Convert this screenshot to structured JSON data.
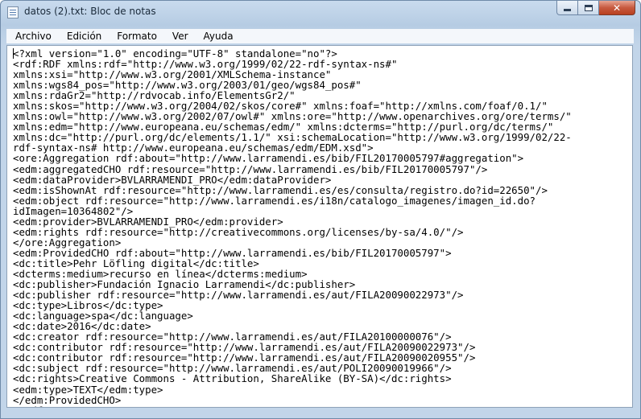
{
  "window": {
    "title": "datos (2).txt: Bloc de notas",
    "close_glyph": "✕"
  },
  "menu": {
    "items": [
      "Archivo",
      "Edición",
      "Formato",
      "Ver",
      "Ayuda"
    ]
  },
  "editor": {
    "lines": [
      "<?xml version=\"1.0\" encoding=\"UTF-8\" standalone=\"no\"?>",
      "<rdf:RDF xmlns:rdf=\"http://www.w3.org/1999/02/22-rdf-syntax-ns#\"",
      "xmlns:xsi=\"http://www.w3.org/2001/XMLSchema-instance\"",
      "xmlns:wgs84_pos=\"http://www.w3.org/2003/01/geo/wgs84_pos#\"",
      "xmlns:rdaGr2=\"http://rdvocab.info/ElementsGr2/\"",
      "xmlns:skos=\"http://www.w3.org/2004/02/skos/core#\" xmlns:foaf=\"http://xmlns.com/foaf/0.1/\"",
      "xmlns:owl=\"http://www.w3.org/2002/07/owl#\" xmlns:ore=\"http://www.openarchives.org/ore/terms/\"",
      "xmlns:edm=\"http://www.europeana.eu/schemas/edm/\" xmlns:dcterms=\"http://purl.org/dc/terms/\"",
      "xmlns:dc=\"http://purl.org/dc/elements/1.1/\" xsi:schemaLocation=\"http://www.w3.org/1999/02/22-",
      "rdf-syntax-ns# http://www.europeana.eu/schemas/edm/EDM.xsd\">",
      "<ore:Aggregation rdf:about=\"http://www.larramendi.es/bib/FIL20170005797#aggregation\">",
      "<edm:aggregatedCHO rdf:resource=\"http://www.larramendi.es/bib/FIL20170005797\"/>",
      "<edm:dataProvider>BVLARRAMENDI_PRO</edm:dataProvider>",
      "<edm:isShownAt rdf:resource=\"http://www.larramendi.es/es/consulta/registro.do?id=22650\"/>",
      "<edm:object rdf:resource=\"http://www.larramendi.es/i18n/catalogo_imagenes/imagen_id.do?",
      "idImagen=10364802\"/>",
      "<edm:provider>BVLARRAMENDI_PRO</edm:provider>",
      "<edm:rights rdf:resource=\"http://creativecommons.org/licenses/by-sa/4.0/\"/>",
      "</ore:Aggregation>",
      "<edm:ProvidedCHO rdf:about=\"http://www.larramendi.es/bib/FIL20170005797\">",
      "<dc:title>Pehr Löfling digital</dc:title>",
      "<dcterms:medium>recurso en línea</dcterms:medium>",
      "<dc:publisher>Fundación Ignacio Larramendi</dc:publisher>",
      "<dc:publisher rdf:resource=\"http://www.larramendi.es/aut/FILA20090022973\"/>",
      "<dc:type>Libros</dc:type>",
      "<dc:language>spa</dc:language>",
      "<dc:date>2016</dc:date>",
      "<dc:creator rdf:resource=\"http://www.larramendi.es/aut/FILA20100000076\"/>",
      "<dc:contributor rdf:resource=\"http://www.larramendi.es/aut/FILA20090022973\"/>",
      "<dc:contributor rdf:resource=\"http://www.larramendi.es/aut/FILA20090020955\"/>",
      "<dc:subject rdf:resource=\"http://www.larramendi.es/aut/POLI20090019966\"/>",
      "<dc:rights>Creative Commons - Attribution, ShareAlike (BY-SA)</dc:rights>",
      "<edm:type>TEXT</edm:type>",
      "</edm:ProvidedCHO>",
      "</rdf:RDF>"
    ]
  }
}
